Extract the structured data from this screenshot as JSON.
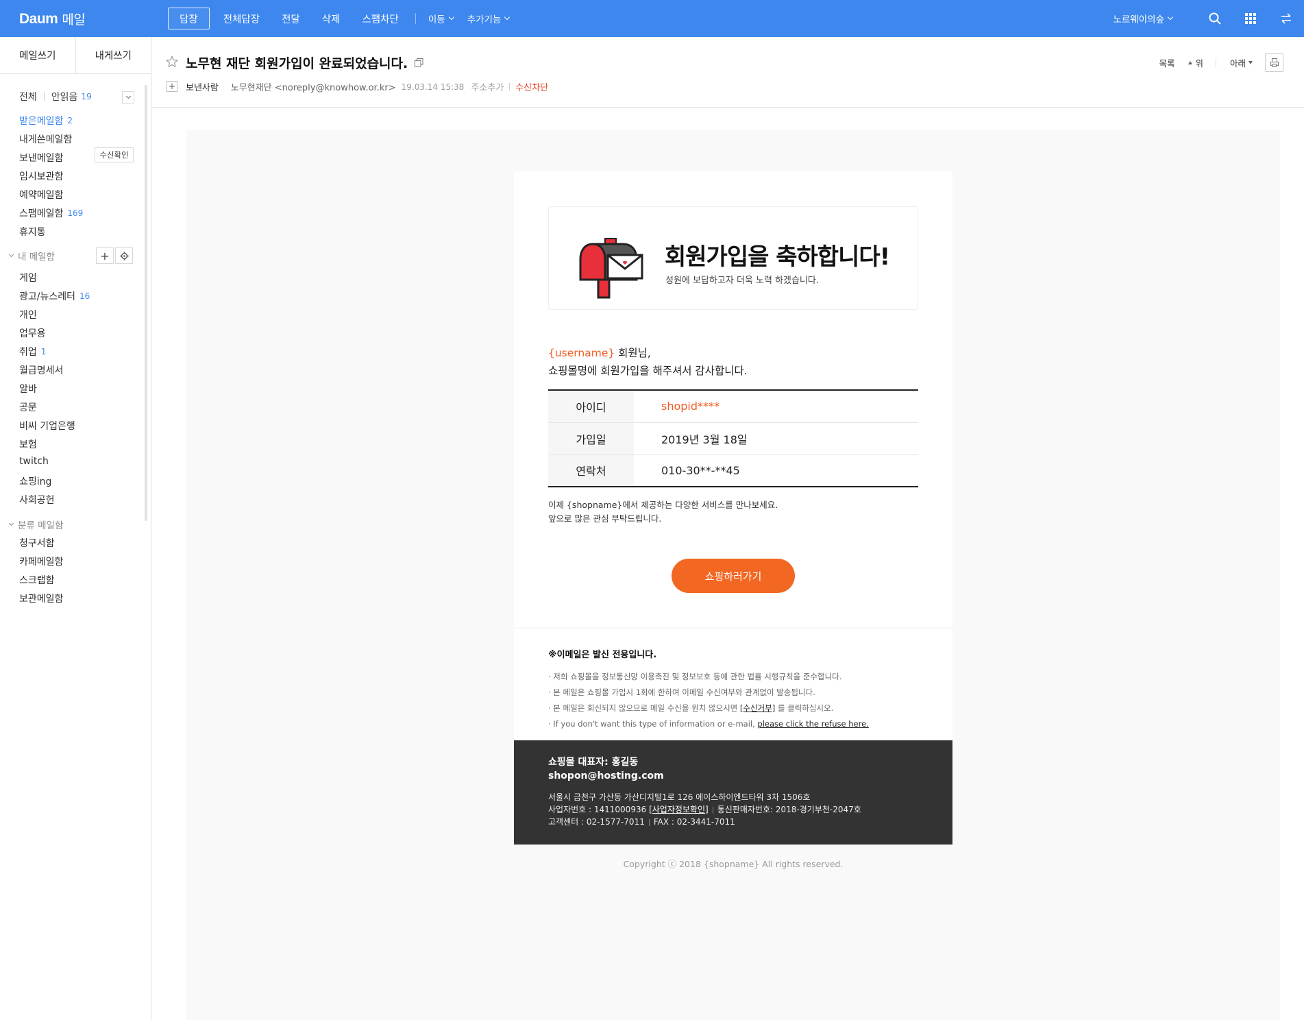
{
  "topbar": {
    "logo": "Daum",
    "service": "메일",
    "actions": [
      "답장",
      "전체답장",
      "전달",
      "삭제",
      "스팸차단"
    ],
    "move": "이동",
    "more": "추가기능",
    "user": "노르웨이의숲"
  },
  "sidebar": {
    "compose": "메일쓰기",
    "to_self": "내게쓰기",
    "all": "전체",
    "unread": "안읽음",
    "unread_count": "19",
    "folders": [
      {
        "label": "받은메일함",
        "count": "2"
      },
      {
        "label": "내게쓴메일함",
        "count": ""
      },
      {
        "label": "보낸메일함",
        "count": ""
      },
      {
        "label": "임시보관함",
        "count": ""
      },
      {
        "label": "예약메일함",
        "count": ""
      },
      {
        "label": "스팸메일함",
        "count": "169"
      },
      {
        "label": "휴지통",
        "count": ""
      }
    ],
    "read_receipt": "수신확인",
    "my_section": "내 메일함",
    "my_folders": [
      {
        "label": "게임",
        "count": ""
      },
      {
        "label": "광고/뉴스레터",
        "count": "16"
      },
      {
        "label": "개인",
        "count": ""
      },
      {
        "label": "업무용",
        "count": ""
      },
      {
        "label": "취업",
        "count": "1"
      },
      {
        "label": "월급명세서",
        "count": ""
      },
      {
        "label": "알바",
        "count": ""
      },
      {
        "label": "공문",
        "count": ""
      },
      {
        "label": "비씨 기업은행",
        "count": ""
      },
      {
        "label": "보험",
        "count": ""
      },
      {
        "label": "twitch",
        "count": ""
      },
      {
        "label": "쇼핑ing",
        "count": ""
      },
      {
        "label": "사회공헌",
        "count": ""
      }
    ],
    "category_section": "분류 메일함",
    "category_folders": [
      "청구서함",
      "카페메일함",
      "스크랩함",
      "보관메일함"
    ]
  },
  "message": {
    "subject": "노무현 재단 회원가입이 완료되었습니다.",
    "sender_label": "보낸사람",
    "sender": "노무현재단 <noreply@knowhow.or.kr>",
    "date": "19.03.14 15:38",
    "add_contact": "주소추가",
    "block": "수신차단",
    "list": "목록",
    "up": "위",
    "down": "아래"
  },
  "email": {
    "hero_title": "회원가입을 축하합니다!",
    "hero_sub": "성원에 보답하고자 더욱 노력 하겠습니다.",
    "greet_user": "{username}",
    "greet_suffix": " 회원님,",
    "greet_line2": "쇼핑몰명에 회원가입을 해주셔서 감사합니다.",
    "rows": [
      {
        "k": "아이디",
        "v": "shopid****"
      },
      {
        "k": "가입일",
        "v": "2019년 3월 18일"
      },
      {
        "k": "연락처",
        "v": "010-30**-**45"
      }
    ],
    "note1": "이제 {shopname}에서 제공하는 다양한 서비스를 만나보세요.",
    "note2": "앞으로 많은 관심 부탁드립니다.",
    "cta": "쇼핑하러가기",
    "notice_title": "※이메일은 발신 전용입니다.",
    "notice1": "· 저희 쇼핑몰을 정보통신망 이용촉진 및 정보보호 등에 관한 법률 시행규칙을 준수합니다.",
    "notice2": "· 본 메일은 쇼핑몰 가입시 1회에 한하여 이메일 수신여부와 관계없이 발송됩니다.",
    "notice3_pre": "· 본 메일은 회신되지 않으므로 메일 수신을 원치 않으시면 ",
    "notice3_link": "[수신거부]",
    "notice3_post": " 를 클릭하십시오.",
    "notice4_pre": "· If you don't want this type of information or e-mail, ",
    "notice4_link": "please click the refuse here.",
    "footer_ceo": "쇼핑몰 대표자: 홍길동",
    "footer_mail": "shopon@hosting.com",
    "footer_addr": "서울시 금천구 가산동 가산디지털1로 126 에이스하이엔드타워 3차 1506호",
    "footer_biz": "사업자번호 : 1411000936",
    "footer_biz_link": "[사업자정보확인]",
    "footer_sales": "통신판매자번호: 2018-경기부천-2047호",
    "footer_cs": "고객센터 : 02-1577-7011",
    "footer_fax": "FAX : 02-3441-7011",
    "copyright": "Copyright ⓒ 2018 {shopname} All rights reserved."
  },
  "colors": {
    "topbar": "#3d87ee",
    "accent": "#f26722",
    "link": "#3d87ee",
    "block": "#e8452b",
    "footer": "#333333"
  }
}
